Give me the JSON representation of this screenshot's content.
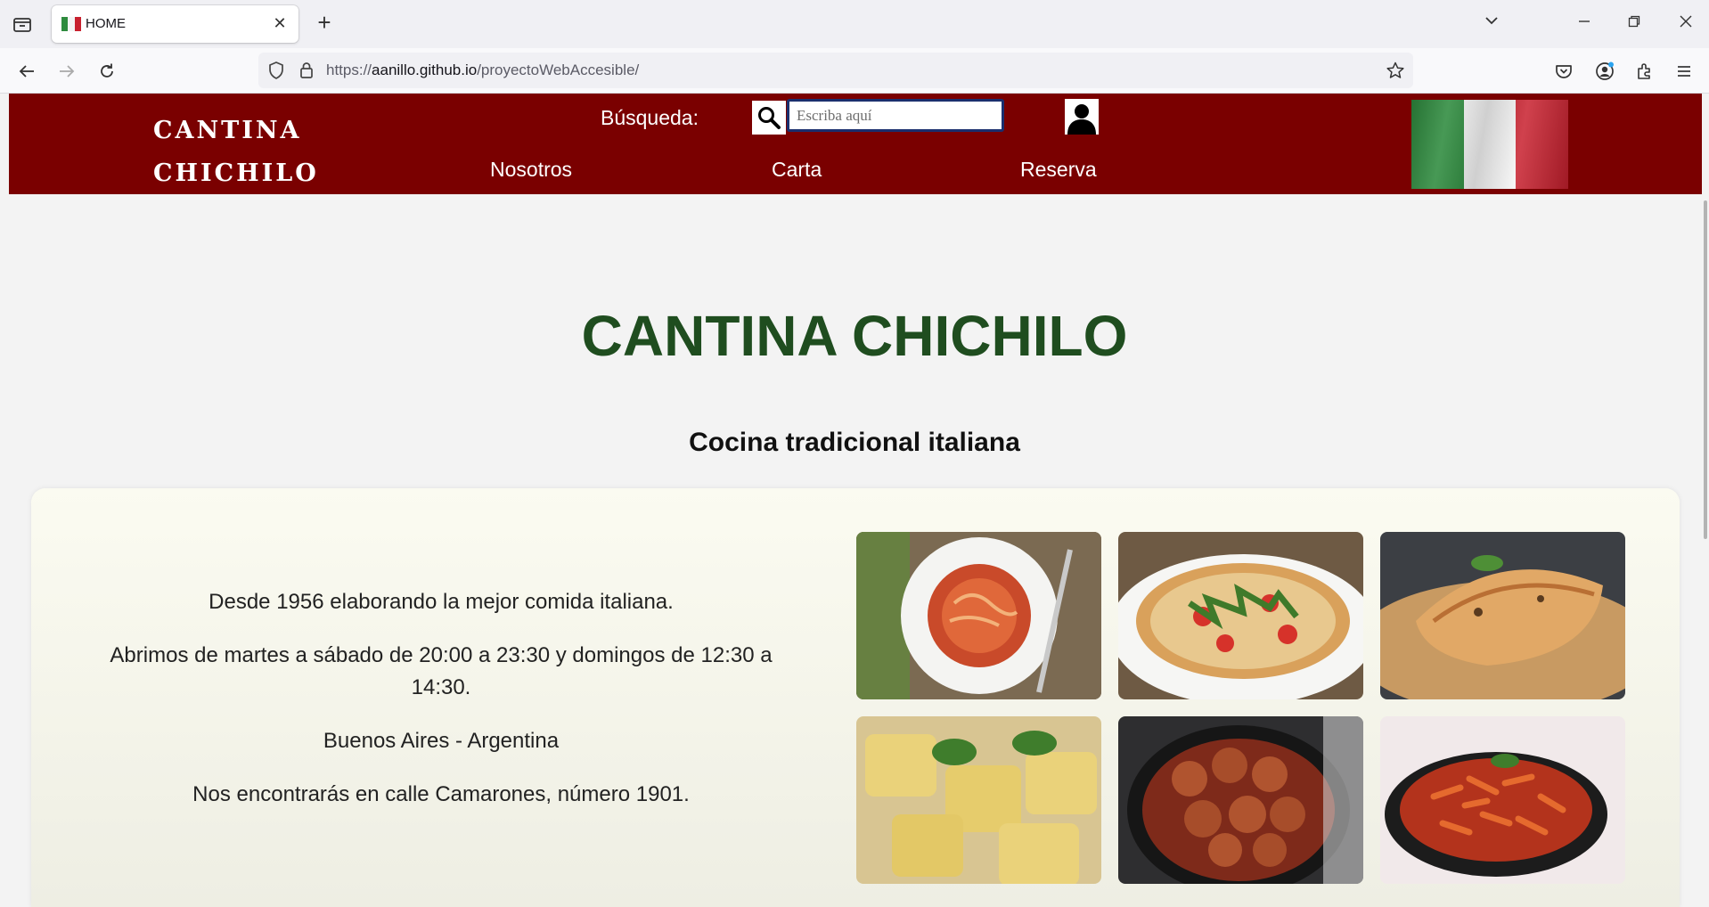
{
  "browser": {
    "tab_title": "HOME",
    "url_host": "aanillo.github.io",
    "url_prefix": "https://",
    "url_path": "/proyectoWebAccesible/"
  },
  "header": {
    "logo_line1": "CANTINA",
    "logo_line2": "CHICHILO",
    "search_label": "Búsqueda:",
    "search_placeholder": "Escriba aquí",
    "nav": [
      "Nosotros",
      "Carta",
      "Reserva"
    ]
  },
  "main": {
    "title": "CANTINA CHICHILO",
    "subtitle": "Cocina tradicional italiana",
    "info": [
      "Desde 1956 elaborando la mejor comida italiana.",
      "Abrimos de martes a sábado de 20:00 a 23:30 y domingos de 12:30 a 14:30.",
      "Buenos Aires - Argentina",
      "Nos encontrarás en calle Camarones, número 1901."
    ]
  },
  "colors": {
    "header_bg": "#7a0000",
    "title_green": "#1f4d1f",
    "flag_green": "#2e8b3e",
    "flag_white": "#f4f4f4",
    "flag_red": "#c8202e"
  }
}
